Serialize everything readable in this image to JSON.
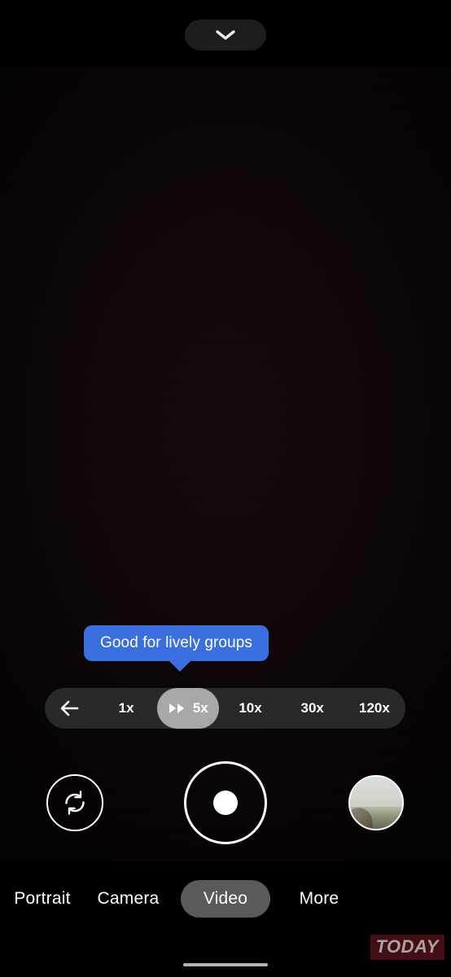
{
  "app": {
    "name": "Camera",
    "screen": "video-viewfinder"
  },
  "topbar": {
    "expand_icon": "chevron-down-icon",
    "expand_label": ""
  },
  "viewfinder": {
    "state": "very-dark-scene",
    "bg_color": "#0a0506"
  },
  "tooltip": {
    "text": "Good for lively groups",
    "bg_color": "#3b6fe0",
    "text_color": "#ffffff",
    "points_to": "5x"
  },
  "zoom_bar": {
    "back_icon": "arrow-left-icon",
    "bg_color": "#292929",
    "selected_bg_color": "#a8a8a8",
    "selected_value": "5x",
    "options": [
      {
        "label": "1x",
        "selected": false,
        "icon": ""
      },
      {
        "label": "5x",
        "selected": true,
        "icon": "fast-forward-icon"
      },
      {
        "label": "10x",
        "selected": false,
        "icon": ""
      },
      {
        "label": "30x",
        "selected": false,
        "icon": ""
      },
      {
        "label": "120x",
        "selected": false,
        "icon": ""
      }
    ]
  },
  "controls": {
    "flip_icon": "camera-flip-icon",
    "flip_label": "",
    "shutter_icon": "record-button-icon",
    "shutter_label": "",
    "gallery_label": ""
  },
  "modes": {
    "selected": "Video",
    "selected_bg_color": "#5a5a5a",
    "items": [
      {
        "label": "Portrait",
        "selected": false
      },
      {
        "label": "Camera",
        "selected": false
      },
      {
        "label": "Video",
        "selected": true
      },
      {
        "label": "More",
        "selected": false
      }
    ]
  },
  "watermark": {
    "text": "TODAY",
    "bg_color": "#4a1018",
    "text_color": "#b9b0b0"
  },
  "system": {
    "home_indicator": ""
  }
}
